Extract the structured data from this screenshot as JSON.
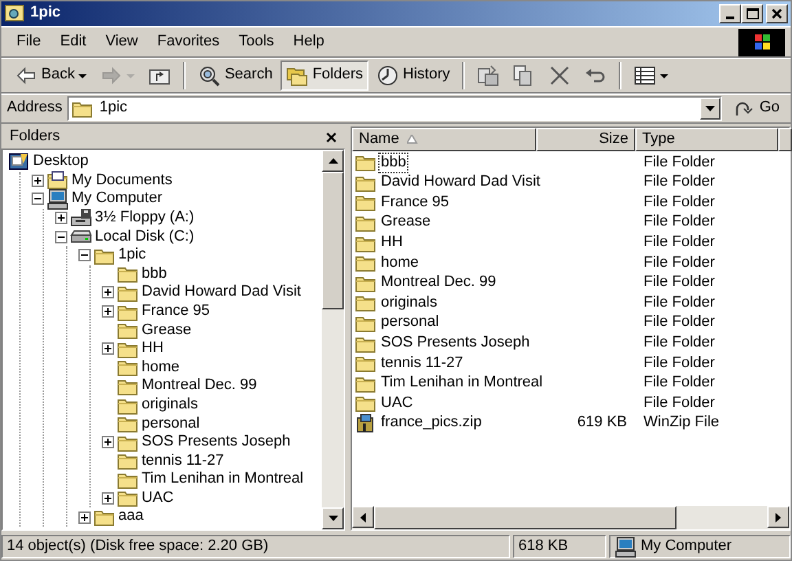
{
  "window": {
    "title": "1pic"
  },
  "menu": [
    "File",
    "Edit",
    "View",
    "Favorites",
    "Tools",
    "Help"
  ],
  "toolbar": [
    {
      "kind": "back",
      "label": "Back",
      "disabled": false
    },
    {
      "kind": "forward",
      "disabled": true
    },
    {
      "kind": "up",
      "disabled": false
    },
    {
      "kind": "search",
      "label": "Search",
      "selected": false
    },
    {
      "kind": "folders",
      "label": "Folders",
      "selected": true
    },
    {
      "kind": "history",
      "label": "History",
      "selected": false
    },
    {
      "kind": "move",
      "disabled": false
    },
    {
      "kind": "copy",
      "disabled": false
    },
    {
      "kind": "delete",
      "disabled": false
    },
    {
      "kind": "undo",
      "disabled": false
    },
    {
      "kind": "views",
      "disabled": false
    }
  ],
  "address": {
    "label": "Address",
    "value": "1pic",
    "go": "Go"
  },
  "folders_pane": {
    "title": "Folders",
    "tree": [
      {
        "kind": "desktop",
        "label": "Desktop",
        "children": [
          {
            "kind": "documents",
            "label": "My Documents",
            "expanded": false
          },
          {
            "kind": "computer",
            "label": "My Computer",
            "expanded": true,
            "children": [
              {
                "kind": "floppy",
                "label": "3½ Floppy (A:)",
                "expanded": false
              },
              {
                "kind": "drive",
                "label": "Local Disk (C:)",
                "expanded": true,
                "children": [
                  {
                    "kind": "folder",
                    "label": "1pic",
                    "expanded": true,
                    "children": [
                      {
                        "kind": "folder",
                        "label": "bbb"
                      },
                      {
                        "kind": "folder",
                        "label": "David Howard Dad Visit",
                        "expanded": false
                      },
                      {
                        "kind": "folder",
                        "label": "France 95",
                        "expanded": false
                      },
                      {
                        "kind": "folder",
                        "label": "Grease"
                      },
                      {
                        "kind": "folder",
                        "label": "HH",
                        "expanded": false
                      },
                      {
                        "kind": "folder",
                        "label": "home"
                      },
                      {
                        "kind": "folder",
                        "label": "Montreal Dec. 99"
                      },
                      {
                        "kind": "folder",
                        "label": "originals"
                      },
                      {
                        "kind": "folder",
                        "label": "personal"
                      },
                      {
                        "kind": "folder",
                        "label": "SOS Presents Joseph",
                        "expanded": false
                      },
                      {
                        "kind": "folder",
                        "label": "tennis 11-27"
                      },
                      {
                        "kind": "folder",
                        "label": "Tim Lenihan in Montreal"
                      },
                      {
                        "kind": "folder",
                        "label": "UAC",
                        "expanded": false
                      }
                    ]
                  },
                  {
                    "kind": "folder",
                    "label": "aaa",
                    "expanded": false
                  }
                ]
              }
            ]
          }
        ]
      }
    ]
  },
  "file_list": {
    "columns": [
      {
        "label": "Name",
        "sorted": true
      },
      {
        "label": "Size",
        "sorted": false
      },
      {
        "label": "Type",
        "sorted": false
      }
    ],
    "rows": [
      {
        "kind": "folder",
        "name": "bbb",
        "type": "File Folder",
        "focused": true
      },
      {
        "kind": "folder",
        "name": "David Howard Dad Visit",
        "type": "File Folder",
        "focused": false
      },
      {
        "kind": "folder",
        "name": "France 95",
        "type": "File Folder",
        "focused": false
      },
      {
        "kind": "folder",
        "name": "Grease",
        "type": "File Folder",
        "focused": false
      },
      {
        "kind": "folder",
        "name": "HH",
        "type": "File Folder",
        "focused": false
      },
      {
        "kind": "folder",
        "name": "home",
        "type": "File Folder",
        "focused": false
      },
      {
        "kind": "folder",
        "name": "Montreal Dec. 99",
        "type": "File Folder",
        "focused": false
      },
      {
        "kind": "folder",
        "name": "originals",
        "type": "File Folder",
        "focused": false
      },
      {
        "kind": "folder",
        "name": "personal",
        "type": "File Folder",
        "focused": false
      },
      {
        "kind": "folder",
        "name": "SOS Presents Joseph",
        "type": "File Folder",
        "focused": false
      },
      {
        "kind": "folder",
        "name": "tennis 11-27",
        "type": "File Folder",
        "focused": false
      },
      {
        "kind": "folder",
        "name": "Tim Lenihan in Montreal",
        "type": "File Folder",
        "focused": false
      },
      {
        "kind": "folder",
        "name": "UAC",
        "type": "File Folder",
        "focused": false
      },
      {
        "kind": "zip",
        "name": "france_pics.zip",
        "size": "619 KB",
        "type": "WinZip File",
        "focused": false
      }
    ]
  },
  "status_bar": {
    "objects": "14 object(s) (Disk free space: 2.20 GB)",
    "size": "618 KB",
    "zone": "My Computer"
  }
}
